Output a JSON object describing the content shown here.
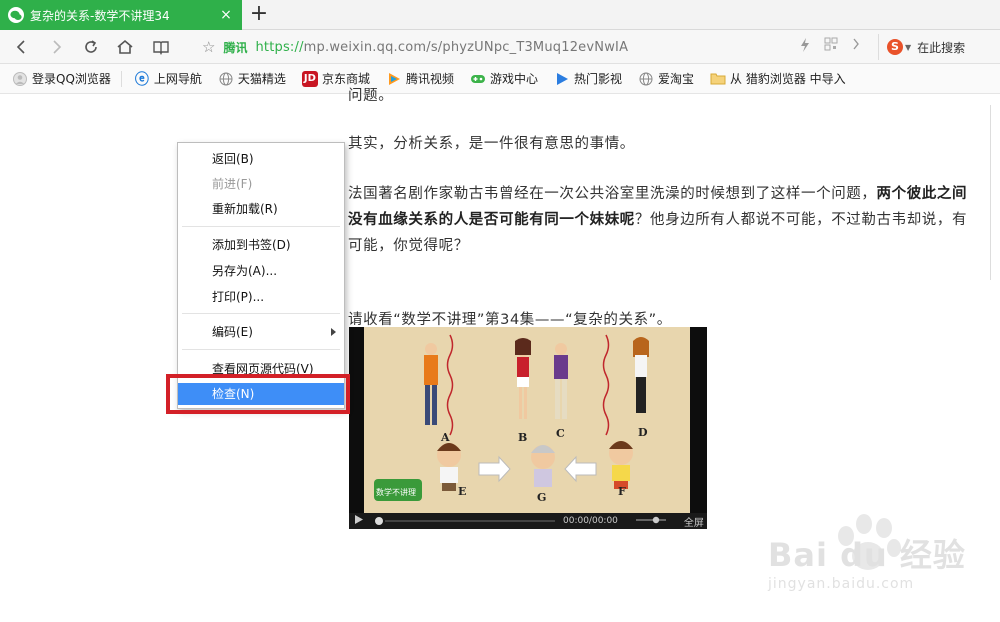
{
  "tab": {
    "title": "复杂的关系-数学不讲理34",
    "close": "×",
    "new_tab": "+"
  },
  "address": {
    "site_tag": "腾讯",
    "url_scheme": "https://",
    "url_rest": "mp.weixin.qq.com/s/phyzUNpc_T3Muq12evNwIA",
    "search_placeholder": "在此搜索",
    "search_engine": "S"
  },
  "bookmarks": [
    {
      "label": "登录QQ浏览器",
      "icon": "user-avatar-icon",
      "color": "#bbbbbb"
    },
    {
      "label": "上网导航",
      "icon": "ie-icon",
      "color": "#1e7ad8"
    },
    {
      "label": "天猫精选",
      "icon": "globe-icon",
      "color": "#888888"
    },
    {
      "label": "京东商城",
      "icon": "jd-icon",
      "color": "#c81623"
    },
    {
      "label": "腾讯视频",
      "icon": "tencent-video-icon",
      "color": "#20a0e0"
    },
    {
      "label": "游戏中心",
      "icon": "gamepad-icon",
      "color": "#3cb34a"
    },
    {
      "label": "热门影视",
      "icon": "play-icon",
      "color": "#2b7de0"
    },
    {
      "label": "爱淘宝",
      "icon": "globe-icon",
      "color": "#888888"
    },
    {
      "label": "从 猎豹浏览器 中导入",
      "icon": "folder-icon",
      "color": "#e8b83a"
    }
  ],
  "article": {
    "partial_top": "问题。",
    "para1": "其实，分析关系，是一件很有意思的事情。",
    "para2_prefix": "法国著名剧作家勒古韦曾经在一次公共浴室里洗澡的时候想到了这样一个问题，",
    "para2_bold": "两个彼此之间没有血缘关系的人是否可能有同一个妹妹呢",
    "para2_suffix": "？他身边所有人都说不可能，不过勒古韦却说，有可能，你觉得呢？",
    "para3": "请收看“数学不讲理”第34集——“复杂的关系”。"
  },
  "video": {
    "labels": [
      "A",
      "B",
      "C",
      "D",
      "E",
      "G",
      "F"
    ],
    "time": "00:00/00:00",
    "fullscreen": "全屏",
    "logo_text": "数学不讲理"
  },
  "context_menu": {
    "back": "返回(B)",
    "forward": "前进(F)",
    "reload": "重新加载(R)",
    "bookmark": "添加到书签(D)",
    "save_as": "另存为(A)...",
    "print": "打印(P)...",
    "encoding": "编码(E)",
    "view_source": "查看网页源代码(V)",
    "inspect": "检查(N)"
  },
  "watermark": {
    "text": "Bai du 经验",
    "sub": "jingyan.baidu.com"
  },
  "colors": {
    "tab_green": "#2fb04a",
    "menu_highlight": "#3e8ef7",
    "annotation_red": "#d32027"
  }
}
